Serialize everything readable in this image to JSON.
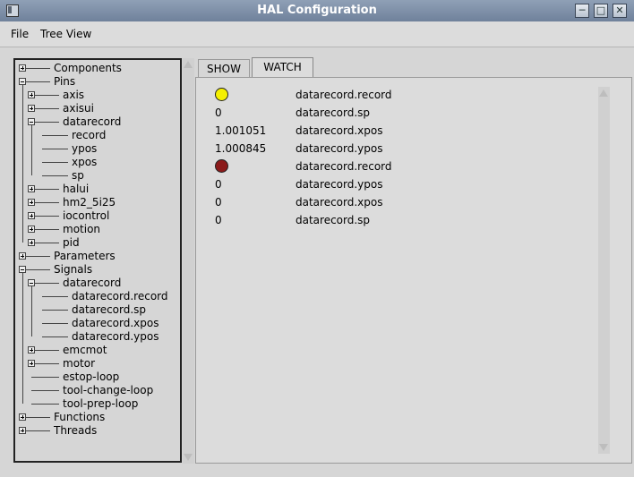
{
  "window": {
    "title": "HAL Configuration"
  },
  "menubar": {
    "file": "File",
    "tree_view": "Tree View"
  },
  "tree": [
    {
      "label": "Components",
      "level": 0,
      "expander": "plus"
    },
    {
      "label": "Pins",
      "level": 0,
      "expander": "minus"
    },
    {
      "label": "axis",
      "level": 1,
      "expander": "plus"
    },
    {
      "label": "axisui",
      "level": 1,
      "expander": "plus"
    },
    {
      "label": "datarecord",
      "level": 1,
      "expander": "minus"
    },
    {
      "label": "record",
      "level": 2,
      "expander": "none"
    },
    {
      "label": "ypos",
      "level": 2,
      "expander": "none"
    },
    {
      "label": "xpos",
      "level": 2,
      "expander": "none"
    },
    {
      "label": "sp",
      "level": 2,
      "expander": "none"
    },
    {
      "label": "halui",
      "level": 1,
      "expander": "plus"
    },
    {
      "label": "hm2_5i25",
      "level": 1,
      "expander": "plus"
    },
    {
      "label": "iocontrol",
      "level": 1,
      "expander": "plus"
    },
    {
      "label": "motion",
      "level": 1,
      "expander": "plus"
    },
    {
      "label": "pid",
      "level": 1,
      "expander": "plus"
    },
    {
      "label": "Parameters",
      "level": 0,
      "expander": "plus"
    },
    {
      "label": "Signals",
      "level": 0,
      "expander": "minus"
    },
    {
      "label": "datarecord",
      "level": 1,
      "expander": "minus"
    },
    {
      "label": "datarecord.record",
      "level": 2,
      "expander": "none"
    },
    {
      "label": "datarecord.sp",
      "level": 2,
      "expander": "none"
    },
    {
      "label": "datarecord.xpos",
      "level": 2,
      "expander": "none"
    },
    {
      "label": "datarecord.ypos",
      "level": 2,
      "expander": "none"
    },
    {
      "label": "emcmot",
      "level": 1,
      "expander": "plus"
    },
    {
      "label": "motor",
      "level": 1,
      "expander": "plus"
    },
    {
      "label": "estop-loop",
      "level": 1,
      "expander": "none"
    },
    {
      "label": "tool-change-loop",
      "level": 1,
      "expander": "none"
    },
    {
      "label": "tool-prep-loop",
      "level": 1,
      "expander": "none"
    },
    {
      "label": "Functions",
      "level": 0,
      "expander": "plus"
    },
    {
      "label": "Threads",
      "level": 0,
      "expander": "plus"
    }
  ],
  "tabs": [
    {
      "label": "SHOW",
      "active": false
    },
    {
      "label": "WATCH",
      "active": true
    }
  ],
  "watch": [
    {
      "kind": "led",
      "led_color": "#f5f000",
      "name": "datarecord.record"
    },
    {
      "kind": "value",
      "value": "0",
      "name": "datarecord.sp"
    },
    {
      "kind": "value",
      "value": "1.001051",
      "name": "datarecord.xpos"
    },
    {
      "kind": "value",
      "value": "1.000845",
      "name": "datarecord.ypos"
    },
    {
      "kind": "led",
      "led_color": "#8b1a1a",
      "name": "datarecord.record"
    },
    {
      "kind": "value",
      "value": "0",
      "name": "datarecord.ypos"
    },
    {
      "kind": "value",
      "value": "0",
      "name": "datarecord.xpos"
    },
    {
      "kind": "value",
      "value": "0",
      "name": "datarecord.sp"
    }
  ]
}
